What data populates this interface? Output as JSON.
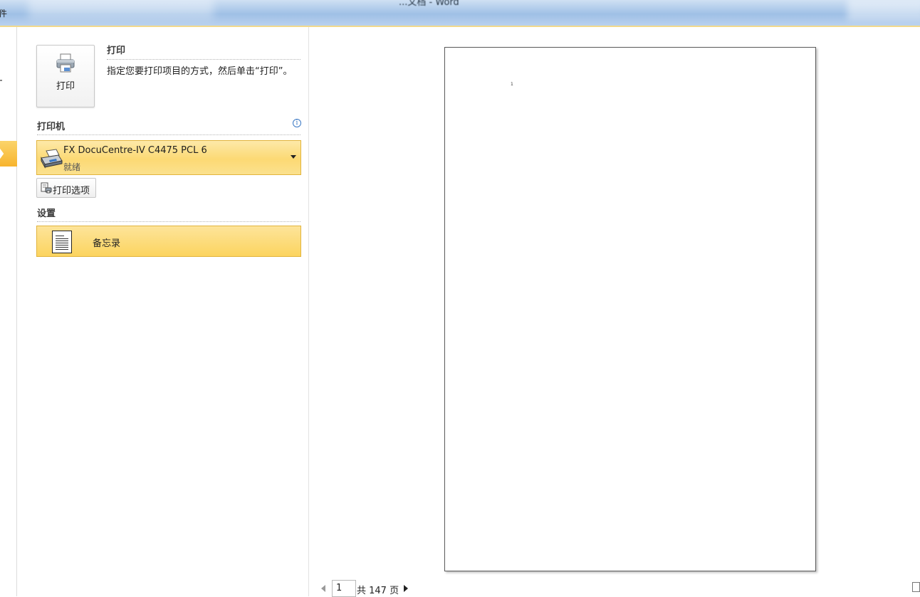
{
  "window": {
    "title": "...文档 - Word"
  },
  "ribbon": {
    "file_tab_label": "件"
  },
  "print_action": {
    "button_label": "打印",
    "heading": "打印",
    "description": "指定您要打印项目的方式，然后单击“打印”。"
  },
  "printer": {
    "section_title": "打印机",
    "name": "FX DocuCentre-IV C4475 PCL 6",
    "status": "就绪",
    "options_button_label": "打印选项"
  },
  "settings": {
    "section_title": "设置",
    "selected_option": "备忘录"
  },
  "preview": {
    "page_mark": "1"
  },
  "page_nav": {
    "current_page": "1",
    "total_label": "共 147 页"
  },
  "colors": {
    "accent_orange": "#f7b42e",
    "selection_yellow": "#fcd974",
    "info_blue": "#3a78c4"
  },
  "icons": {
    "print_button": "printer-icon",
    "printer_selector": "printer-icon",
    "printer_info": "info-icon",
    "print_options": "print-options-icon",
    "setting": "document-icon",
    "nav_prev": "triangle-left-icon",
    "nav_next": "triangle-right-icon"
  }
}
